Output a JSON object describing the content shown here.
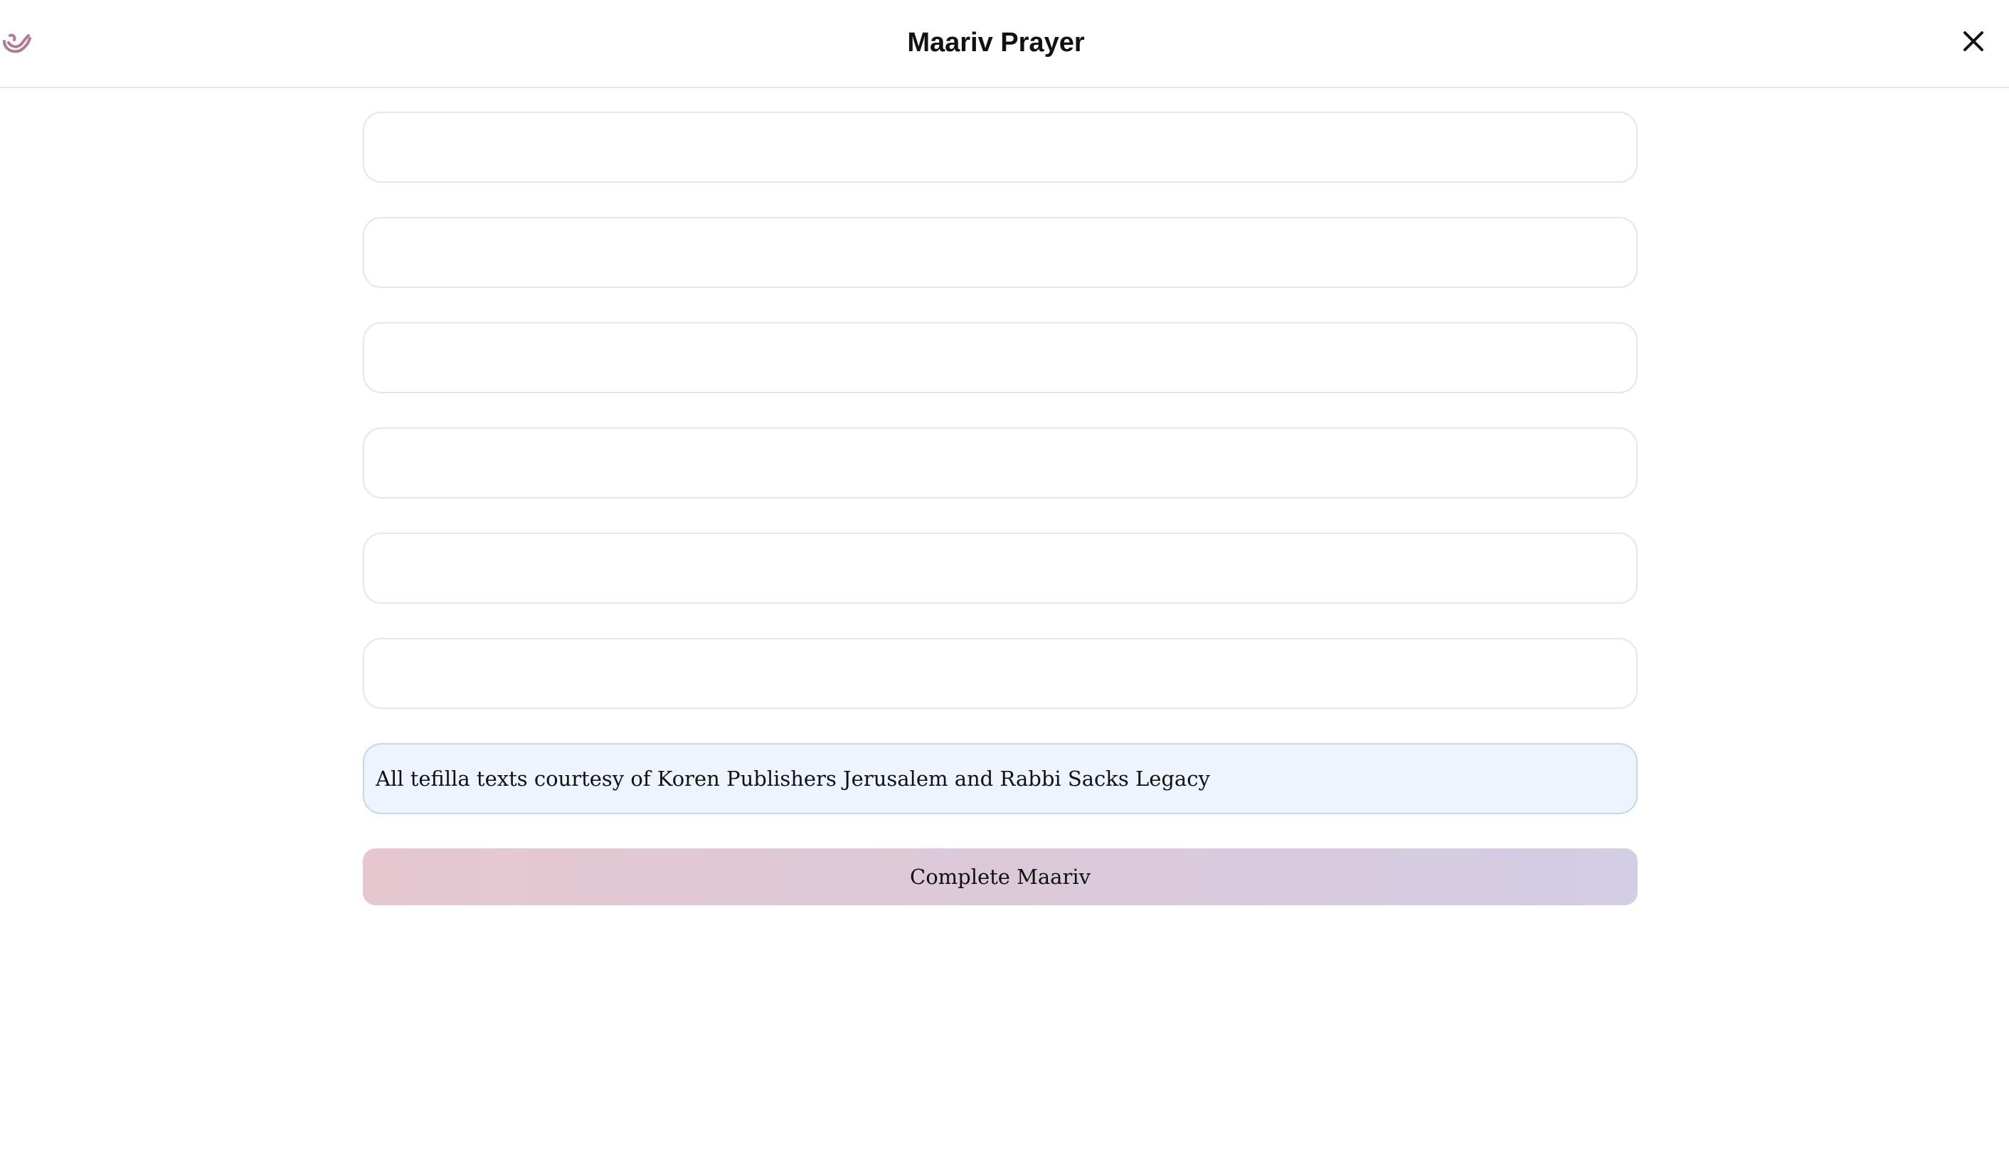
{
  "header": {
    "title": "Maariv Prayer",
    "logo_icon": "dove-icon",
    "close_icon": "close-icon"
  },
  "sections": {
    "count": 6,
    "items": [
      {
        "label": ""
      },
      {
        "label": ""
      },
      {
        "label": ""
      },
      {
        "label": ""
      },
      {
        "label": ""
      },
      {
        "label": ""
      }
    ]
  },
  "credit": {
    "text": "All tefilla texts courtesy of Koren Publishers Jerusalem and Rabbi Sacks Legacy"
  },
  "actions": {
    "complete_label": "Complete Maariv"
  },
  "colors": {
    "brand_logo": "#b07a94",
    "credit_background": "#eef4fd",
    "credit_border": "#c2d6f4",
    "button_gradient_start": "#e6c7d0",
    "button_gradient_end": "#d3cde6",
    "card_border": "#e6e6ea"
  }
}
